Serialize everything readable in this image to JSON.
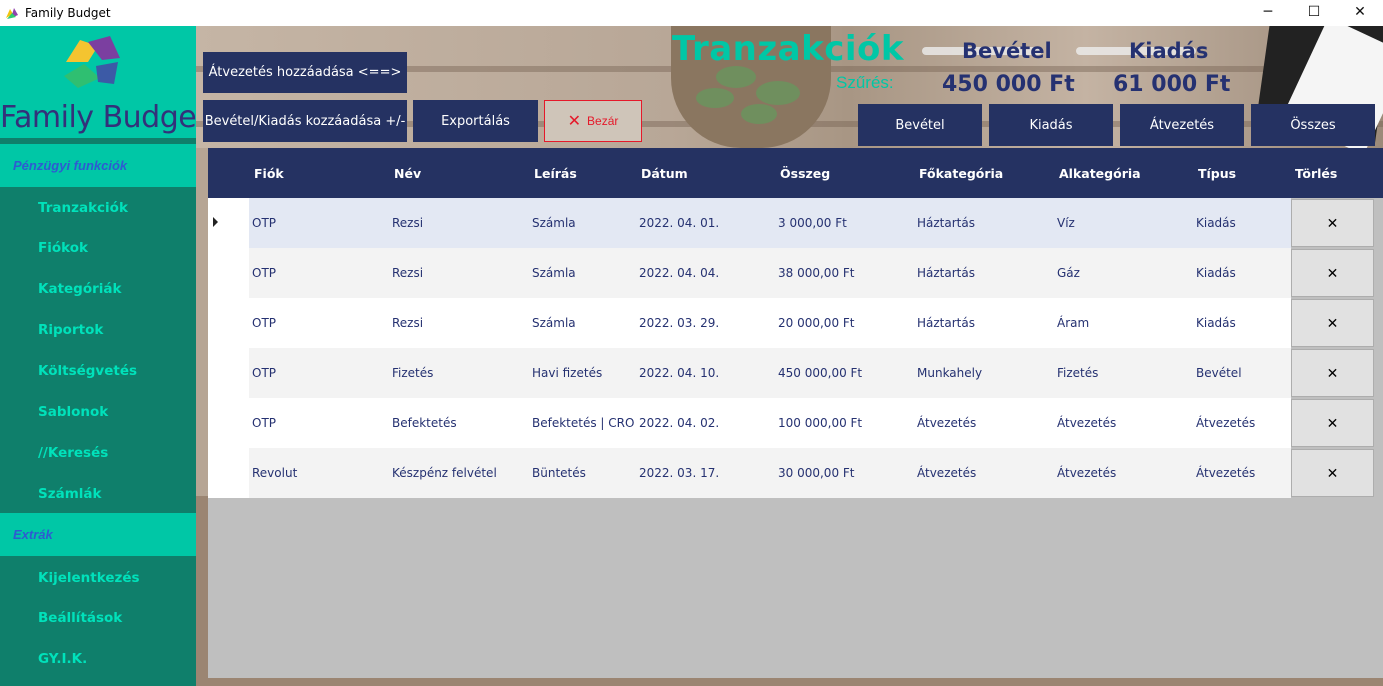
{
  "window": {
    "title": "Family Budget",
    "controls": [
      "─",
      "☐",
      "✕"
    ]
  },
  "sidebar": {
    "logo_text": "Family Budget",
    "section1": "Pénzügyi funkciók",
    "items1": [
      {
        "label": "Tranzakciók"
      },
      {
        "label": "Fiókok"
      },
      {
        "label": "Kategóriák"
      },
      {
        "label": "Riportok"
      },
      {
        "label": "Költségvetés"
      },
      {
        "label": "Sablonok"
      },
      {
        "label": "//Keresés"
      },
      {
        "label": "Számlák"
      }
    ],
    "section2": "Extrák",
    "items2": [
      {
        "label": "Kijelentkezés"
      },
      {
        "label": "Beállítások"
      },
      {
        "label": "GY.I.K."
      }
    ]
  },
  "header": {
    "title": "Tranzakciók",
    "filter_label": "Szűrés:",
    "income_label": "Bevétel",
    "expense_label": "Kiadás",
    "income_amount": "450 000 Ft",
    "expense_amount": "61 000 Ft"
  },
  "toolbar": {
    "add_transfer": "Átvezetés hozzáadása <==>",
    "add_income_expense": "Bevétel/Kiadás kozzáadása +/-",
    "export": "Exportálás",
    "close": "Bezár"
  },
  "filters": [
    "Bevétel",
    "Kiadás",
    "Átvezetés",
    "Összes"
  ],
  "table": {
    "columns": [
      "Fiók",
      "Név",
      "Leírás",
      "Dátum",
      "Összeg",
      "Főkategória",
      "Alkategória",
      "Típus",
      "Törlés"
    ],
    "rows": [
      {
        "account": "OTP",
        "name": "Rezsi",
        "desc": "Számla",
        "date": "2022. 04. 01.",
        "amount": "3 000,00 Ft",
        "main_cat": "Háztartás",
        "sub_cat": "Víz",
        "type": "Kiadás",
        "delete": "✕"
      },
      {
        "account": "OTP",
        "name": "Rezsi",
        "desc": "Számla",
        "date": "2022. 04. 04.",
        "amount": "38 000,00 Ft",
        "main_cat": "Háztartás",
        "sub_cat": "Gáz",
        "type": "Kiadás",
        "delete": "✕"
      },
      {
        "account": "OTP",
        "name": "Rezsi",
        "desc": "Számla",
        "date": "2022. 03. 29.",
        "amount": "20 000,00 Ft",
        "main_cat": "Háztartás",
        "sub_cat": "Áram",
        "type": "Kiadás",
        "delete": "✕"
      },
      {
        "account": "OTP",
        "name": "Fizetés",
        "desc": "Havi fizetés",
        "date": "2022. 04. 10.",
        "amount": "450 000,00 Ft",
        "main_cat": "Munkahely",
        "sub_cat": "Fizetés",
        "type": "Bevétel",
        "delete": "✕"
      },
      {
        "account": "OTP",
        "name": "Befektetés",
        "desc": "Befektetés | CRO",
        "date": "2022. 04. 02.",
        "amount": "100 000,00 Ft",
        "main_cat": "Átvezetés",
        "sub_cat": "Átvezetés",
        "type": "Átvezetés",
        "delete": "✕"
      },
      {
        "account": "Revolut",
        "name": "Készpénz felvétel",
        "desc": "Büntetés",
        "date": "2022. 03. 17.",
        "amount": "30 000,00 Ft",
        "main_cat": "Átvezetés",
        "sub_cat": "Átvezetés",
        "type": "Átvezetés",
        "delete": "✕"
      }
    ]
  },
  "colors": {
    "sidebar_bg": "#0f7f6b",
    "accent_teal": "#00c7a6",
    "navy": "#253262",
    "close_red": "#e5192a"
  }
}
